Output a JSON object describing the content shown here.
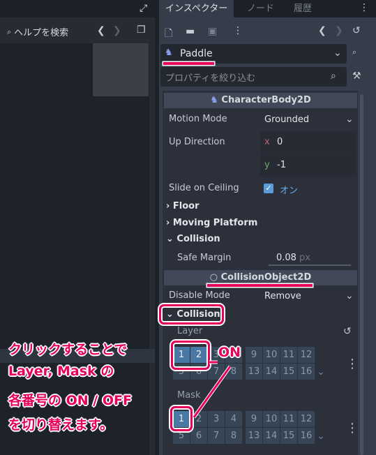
{
  "left_panel": {
    "help_search_label": "ヘルプを検索"
  },
  "tabs": [
    {
      "label": "インスペクター",
      "active": true
    },
    {
      "label": "ノード"
    },
    {
      "label": "履歴"
    }
  ],
  "inspector": {
    "object_name": "Paddle",
    "filter_placeholder": "プロパティを絞り込む",
    "class_header": "CharacterBody2D",
    "props": {
      "motion_mode_label": "Motion Mode",
      "motion_mode_value": "Grounded",
      "up_direction_label": "Up Direction",
      "up_x_axis": "x",
      "up_x": "0",
      "up_y_axis": "y",
      "up_y": "-1",
      "slide_label": "Slide on Ceiling",
      "slide_value": "オン",
      "floor": "Floor",
      "moving_platform": "Moving Platform",
      "collision": "Collision",
      "safe_margin_label": "Safe Margin",
      "safe_margin_value": "0.08",
      "safe_margin_unit": "px"
    },
    "collision_object_header": "CollisionObject2D",
    "disable_mode_label": "Disable Mode",
    "disable_mode_value": "Remove",
    "collision_section": "Collision",
    "layer_label": "Layer",
    "mask_label": "Mask",
    "layer_on": [
      1,
      2
    ],
    "mask_on": [
      1
    ],
    "grid_numbers": [
      "1",
      "2",
      "3",
      "4",
      "9",
      "10",
      "11",
      "12",
      "5",
      "6",
      "7",
      "8",
      "13",
      "14",
      "15",
      "16"
    ]
  },
  "annotation": {
    "lines": [
      "クリックすることで",
      "Layer, Mask の",
      "各番号の ON / OFF",
      "を切り替えます。"
    ],
    "on_label": "ON",
    "color": "#e6005c"
  },
  "colors": {
    "accent_on": "#4a78a5",
    "cell_off": "#364657",
    "panel": "#2b303a"
  }
}
